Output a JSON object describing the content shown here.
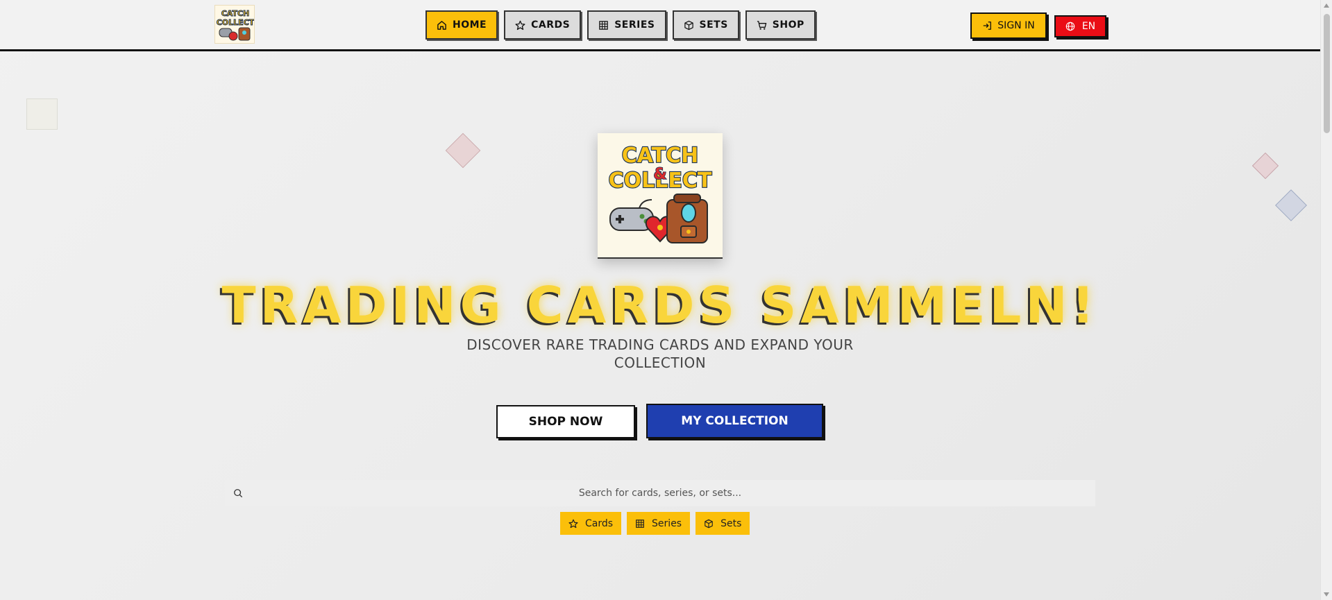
{
  "header": {
    "logo_alt": "CATCH & COLLECT",
    "nav": [
      {
        "label": "HOME",
        "icon": "home-icon",
        "active": true
      },
      {
        "label": "CARDS",
        "icon": "star-icon",
        "active": false
      },
      {
        "label": "SERIES",
        "icon": "grid-icon",
        "active": false
      },
      {
        "label": "SETS",
        "icon": "box-icon",
        "active": false
      },
      {
        "label": "SHOP",
        "icon": "cart-icon",
        "active": false
      }
    ],
    "sign_in": "SIGN IN",
    "language": "EN"
  },
  "hero": {
    "logo_line1": "CATCH",
    "logo_amp": "&",
    "logo_line2": "COLLECT",
    "title": "TRADING CARDS SAMMELN!",
    "subtitle": "DISCOVER RARE TRADING CARDS AND EXPAND YOUR COLLECTION",
    "shop_now": "SHOP NOW",
    "my_collection": "MY COLLECTION"
  },
  "search": {
    "placeholder": "Search for cards, series, or sets..."
  },
  "filters": [
    {
      "label": "Cards",
      "icon": "star-icon"
    },
    {
      "label": "Series",
      "icon": "grid-icon"
    },
    {
      "label": "Sets",
      "icon": "box-icon"
    }
  ],
  "colors": {
    "accent_yellow": "#fbbf0a",
    "language_red": "#ea0d16",
    "collection_blue": "#1f3fb0",
    "title_yellow": "#f9d53b"
  }
}
